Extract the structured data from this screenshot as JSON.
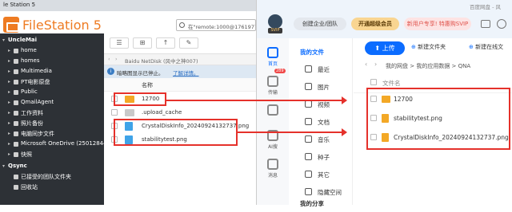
{
  "filestation": {
    "window_title": "le Station 5",
    "app_name": "FileStation 5",
    "search_text": "在\"remote:1000@17619777",
    "toolbar": {
      "view": "☰",
      "new": "⊞",
      "upload": "↑",
      "tools": "✎"
    },
    "path_text": "Baidu NetDisk (风中之神007)",
    "info_text": "暗略图显示已停止。",
    "info_link": "了解详情。",
    "column_name": "名称",
    "sidebar": {
      "root": "UncleMai",
      "items": [
        "home",
        "homes",
        "Multimedia",
        "PT电影原盘",
        "Public",
        "QmailAgent",
        "工作资料",
        "照片备份",
        "电脑同步文件",
        "Microsoft OneDrive (25012844",
        "快照"
      ],
      "qsync": "Qsync",
      "qsync_items": [
        "已接受的团队文件夹",
        "回收站"
      ]
    },
    "files": [
      "12700",
      ".upload_cache",
      "CrystalDiskInfo_20240924132737.png",
      "stabilitytest.png"
    ]
  },
  "baidu": {
    "window_label": "百度网盘 - 风",
    "svip": "SVIP",
    "btn_enterprise": "创建企业/团队",
    "btn_vip": "开通超级会员",
    "btn_promo": "新用户专享! 特惠购SVIP",
    "nav": [
      "首页",
      "传输",
      "",
      "AI搜",
      "消息"
    ],
    "nav_badge": "289",
    "my_files": "我的文件",
    "upload": "上传",
    "new_folder": "新建文件夹",
    "new_online": "新建在线文",
    "breadcrumb": "我的网盘 > 我的应用数据 > QNA",
    "col_name": "文件名",
    "categories": [
      "最近",
      "图片",
      "视频",
      "文档",
      "音乐",
      "种子",
      "其它",
      "隐藏空间"
    ],
    "my_share": "我的分享",
    "files": [
      "12700",
      "stabilitytest.png",
      "CrystalDiskInfo_20240924132737.png"
    ]
  },
  "colors": {
    "accent_orange": "#ee7b22",
    "sidebar_dark": "#2d3136",
    "baidu_blue": "#0b6cff",
    "annotation_red": "#e5312b"
  }
}
